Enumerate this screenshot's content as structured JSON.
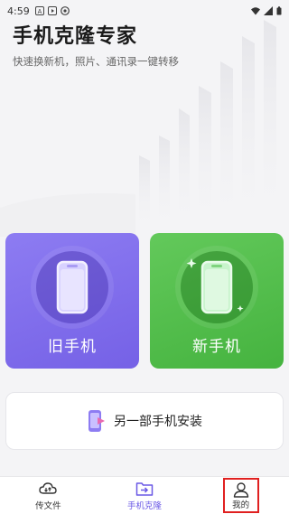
{
  "status_bar": {
    "time": "4:59",
    "left_icons": [
      "a-icon",
      "play-icon",
      "circle-icon"
    ],
    "right_icons": [
      "wifi-icon",
      "signal-icon",
      "battery-icon"
    ]
  },
  "header": {
    "title": "手机克隆专家",
    "subtitle": "快速换新机，照片、通讯录一键转移"
  },
  "cards": {
    "old_phone_label": "旧手机",
    "new_phone_label": "新手机"
  },
  "install": {
    "label": "另一部手机安装"
  },
  "bottom_nav": {
    "items": [
      {
        "label": "传文件",
        "icon": "cloud-transfer-icon"
      },
      {
        "label": "手机克隆",
        "icon": "folder-transfer-icon"
      },
      {
        "label": "我的",
        "icon": "user-icon"
      }
    ],
    "active_index": 1
  },
  "colors": {
    "old_card": "#7a66e9",
    "new_card": "#4eba47",
    "accent": "#6a58e6",
    "highlight_box": "#e02020"
  }
}
